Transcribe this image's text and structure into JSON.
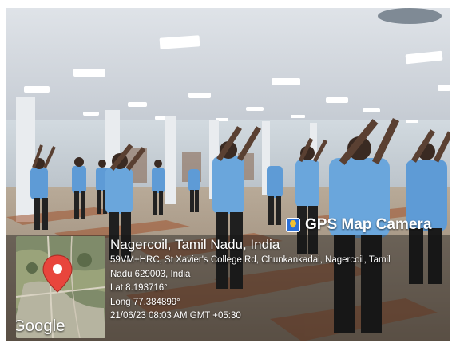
{
  "brand": {
    "icon": "gps-map-camera-icon",
    "label": "GPS Map Camera"
  },
  "map": {
    "pin_icon": "location-pin-icon",
    "attribution": "Google",
    "pin_color": "#e8453c"
  },
  "location": {
    "title": "Nagercoil, Tamil Nadu, India",
    "address_line1": "59VM+HRC, St Xavier's College Rd, Chunkankadai, Nagercoil, Tamil",
    "address_line2": "Nadu 629003, India",
    "latitude": "Lat 8.193716°",
    "longitude": "Long 77.384899°",
    "timestamp": "21/06/23 08:03 AM GMT +05:30"
  }
}
